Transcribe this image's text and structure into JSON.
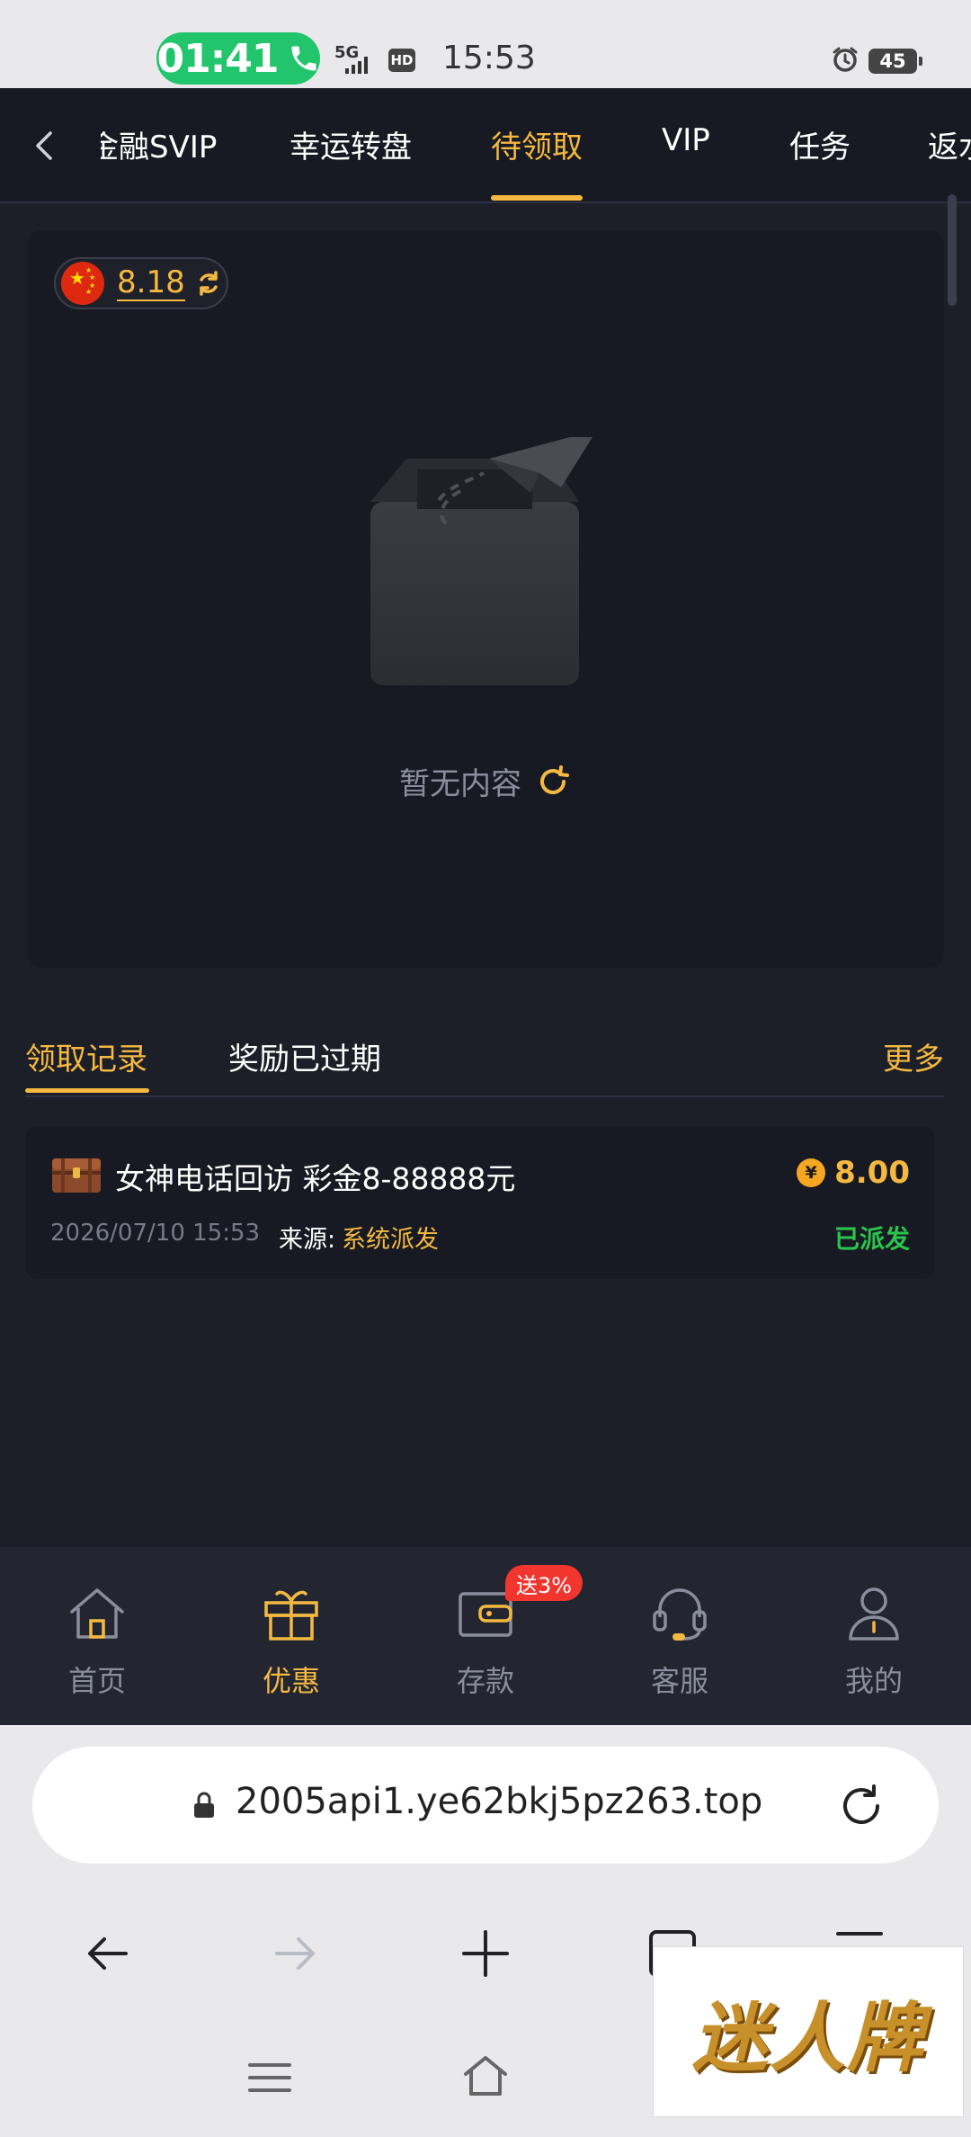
{
  "status_bar": {
    "call_timer": "01:41",
    "network": "5G",
    "hd": "HD",
    "time": "15:53",
    "battery": "45"
  },
  "top_tabs": [
    {
      "label": "金融SVIP",
      "active": false
    },
    {
      "label": "幸运转盘",
      "active": false
    },
    {
      "label": "待领取",
      "active": true
    },
    {
      "label": "VIP",
      "active": false
    },
    {
      "label": "任务",
      "active": false
    },
    {
      "label": "返水",
      "active": false
    }
  ],
  "balance": {
    "value": "8.18"
  },
  "empty_state": {
    "text": "暂无内容"
  },
  "record_tabs": {
    "claimed": "领取记录",
    "expired": "奖励已过期",
    "more": "更多"
  },
  "records": [
    {
      "title": "女神电话回访 彩金8-88888元",
      "amount": "8.00",
      "datetime": "2026/07/10 15:53",
      "source_label": "来源:",
      "source_value": "系统派发",
      "status": "已派发"
    }
  ],
  "bottom_nav": [
    {
      "label": "首页",
      "active": false
    },
    {
      "label": "优惠",
      "active": true
    },
    {
      "label": "存款",
      "active": false,
      "badge": "送3%"
    },
    {
      "label": "客服",
      "active": false
    },
    {
      "label": "我的",
      "active": false
    }
  ],
  "browser": {
    "url": "2005api1.ye62bkj5pz263.top"
  },
  "watermark": {
    "text": "迷人牌"
  },
  "colors": {
    "accent": "#f5b942",
    "background": "#1c1f28",
    "card": "#171a22",
    "success": "#2bc44c",
    "badge": "#f2352e",
    "call_pill": "#22c56b"
  }
}
